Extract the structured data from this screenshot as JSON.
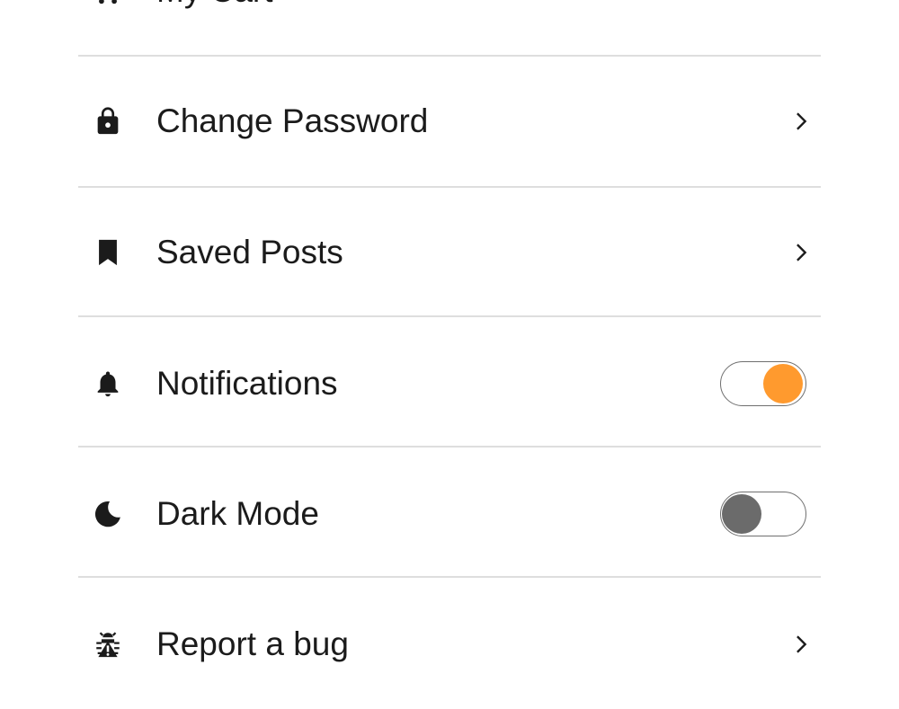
{
  "colors": {
    "accent": "#FF9A2E",
    "knob_off": "#6B6B6B",
    "divider": "#DEDEDE",
    "text": "#1B1B1B"
  },
  "menu": {
    "items": [
      {
        "id": "my-cart",
        "label": "My Cart",
        "icon": "cart-icon",
        "control": "chevron"
      },
      {
        "id": "change-password",
        "label": "Change Password",
        "icon": "lock-icon",
        "control": "chevron"
      },
      {
        "id": "saved-posts",
        "label": "Saved Posts",
        "icon": "bookmark-icon",
        "control": "chevron"
      },
      {
        "id": "notifications",
        "label": "Notifications",
        "icon": "bell-icon",
        "control": "toggle",
        "enabled": true
      },
      {
        "id": "dark-mode",
        "label": "Dark Mode",
        "icon": "moon-icon",
        "control": "toggle",
        "enabled": false
      },
      {
        "id": "report-bug",
        "label": "Report a bug",
        "icon": "bug-icon",
        "control": "chevron"
      }
    ]
  }
}
